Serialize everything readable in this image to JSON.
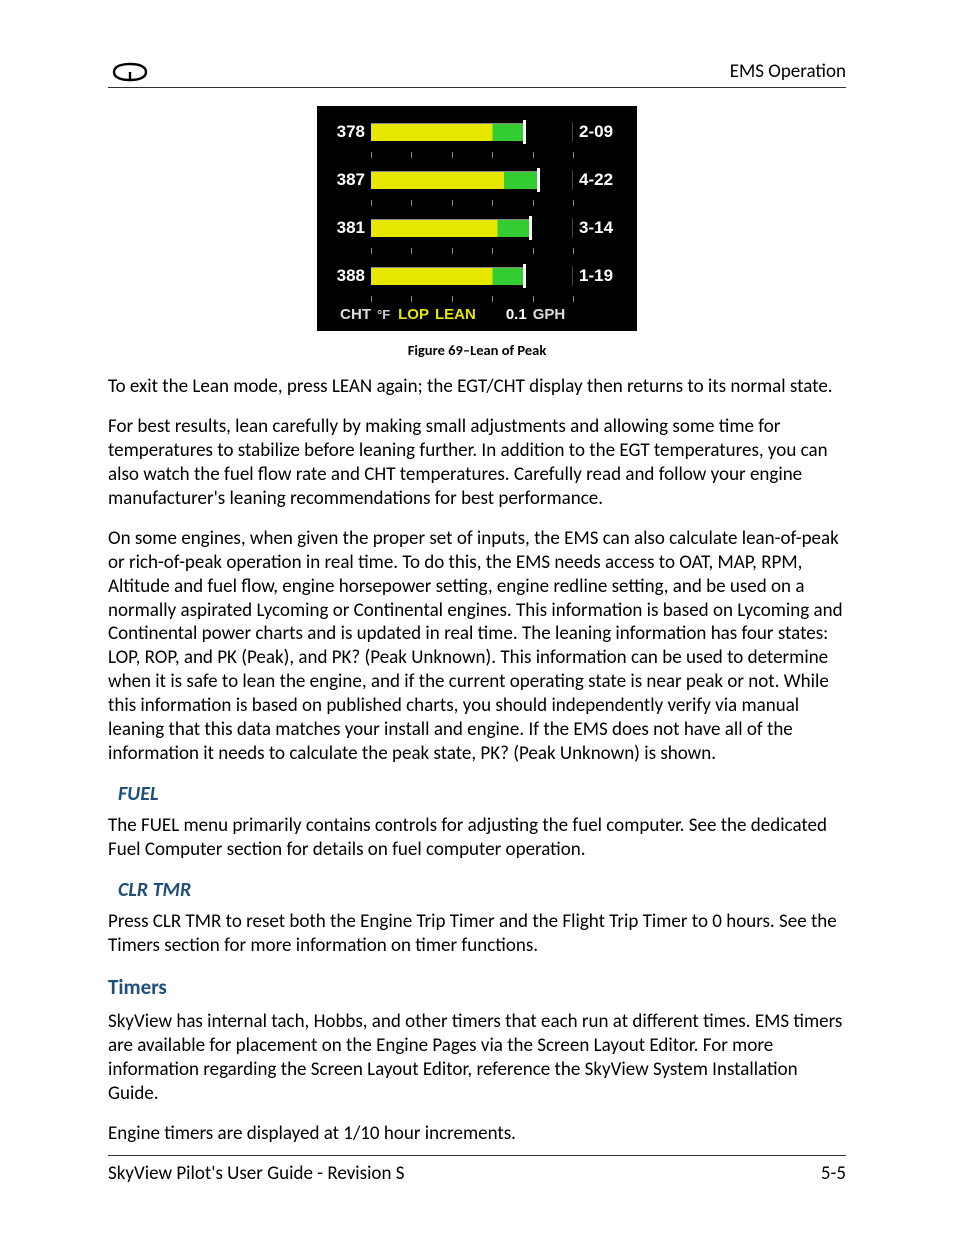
{
  "header": {
    "section": "EMS Operation"
  },
  "chart_data": {
    "type": "bar",
    "title": "Lean of Peak CHT bar display",
    "rows": [
      {
        "left_value": "378",
        "bar_pct": 75,
        "marker_pct": 75,
        "right_value": "2-09"
      },
      {
        "left_value": "387",
        "bar_pct": 82,
        "marker_pct": 82,
        "right_value": "4-22"
      },
      {
        "left_value": "381",
        "bar_pct": 78,
        "marker_pct": 78,
        "right_value": "3-14"
      },
      {
        "left_value": "388",
        "bar_pct": 75,
        "marker_pct": 75,
        "right_value": "1-19"
      }
    ],
    "axis": {
      "label_left": "CHT",
      "units": "°F",
      "status1": "LOP",
      "status2": "LEAN",
      "value": "0.1",
      "value_units": "GPH"
    }
  },
  "figure_caption": "Figure 69–Lean of Peak",
  "paragraphs": {
    "p1": "To exit the Lean mode, press LEAN again; the EGT/CHT display then returns to its normal state.",
    "p2": "For best results, lean carefully by making small adjustments and allowing some time for temperatures to stabilize before leaning further. In addition to the EGT temperatures, you can also watch the fuel flow rate and CHT temperatures. Carefully read and follow your engine manufacturer's leaning recommendations for best performance.",
    "p3": "On some engines, when given the proper set of inputs, the EMS can also calculate lean-of-peak or rich-of-peak operation in real time. To do this, the EMS needs access to OAT, MAP, RPM, Altitude and fuel flow, engine horsepower setting, engine redline setting, and be used on a normally aspirated Lycoming or Continental engines. This information is based on Lycoming and Continental power charts and is updated in real time. The leaning information has four states: LOP, ROP, and PK (Peak), and PK? (Peak Unknown). This information can be used to determine when it is safe to lean the engine, and if the current operating state is near peak or not. While this information is based on published charts, you should independently verify via manual leaning that this data matches your install and engine. If the EMS does not have all of the information it needs to calculate the peak state, PK? (Peak Unknown) is shown.",
    "h_fuel": "FUEL",
    "p_fuel": "The FUEL menu primarily contains controls for adjusting the fuel computer. See the dedicated Fuel Computer section for details on fuel computer operation.",
    "h_clr": "CLR TMR",
    "p_clr": "Press CLR TMR to reset both the Engine Trip Timer and the Flight Trip Timer to 0 hours. See the Timers section for more information on timer functions.",
    "h_timers": "Timers",
    "p_timers1": "SkyView has internal tach, Hobbs, and other timers that each run at different times. EMS timers are available for placement on the Engine Pages via the Screen Layout Editor. For more information regarding the Screen Layout Editor, reference the SkyView System Installation Guide.",
    "p_timers2": "Engine timers are displayed at 1/10 hour increments."
  },
  "footer": {
    "left": "SkyView Pilot's User Guide - Revision S",
    "right": "5-5"
  }
}
